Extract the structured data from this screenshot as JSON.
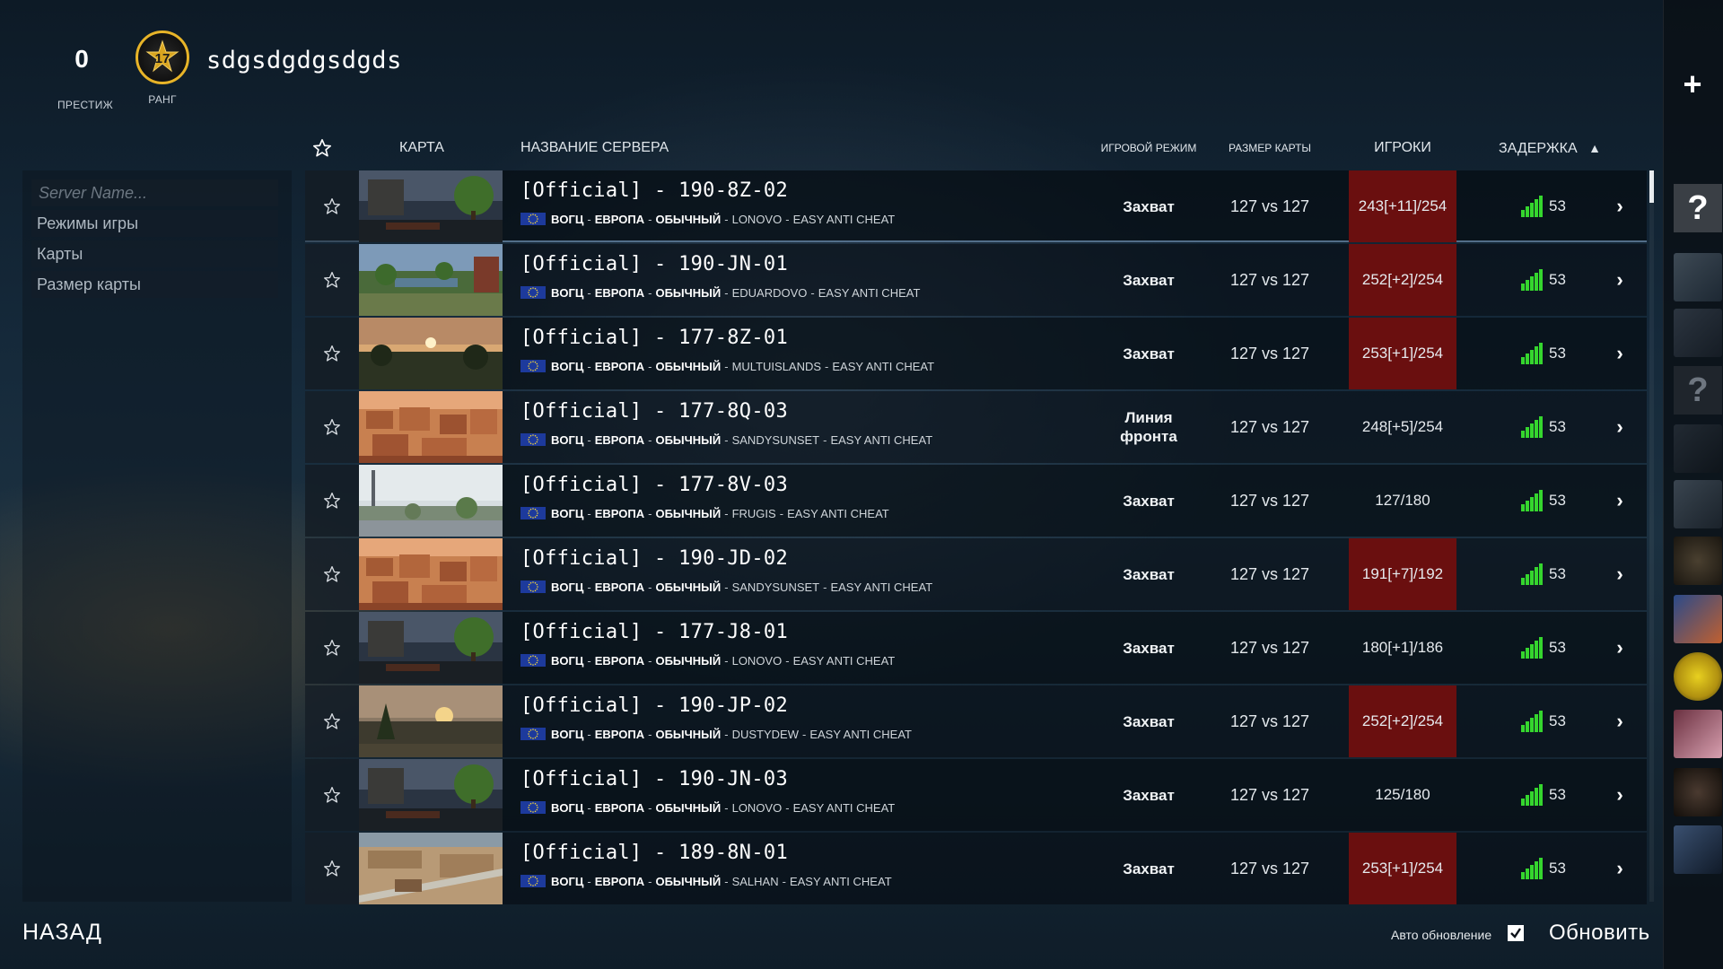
{
  "header": {
    "prestige_value": "0",
    "prestige_label": "ПРЕСТИЖ",
    "rank_value": "17",
    "rank_label": "РАНГ",
    "username": "sdgsdgdgsdgds"
  },
  "filters": {
    "search_placeholder": "Server Name...",
    "items": [
      "Режимы игры",
      "Карты",
      "Размер карты"
    ]
  },
  "columns": {
    "map": "КАРТА",
    "server_name": "НАЗВАНИЕ СЕРВЕРА",
    "game_mode": "ИГРОВОЙ РЕЖИМ",
    "map_size": "РАЗМЕР КАРТЫ",
    "players": "ИГРОКИ",
    "ping": "ЗАДЕРЖКА",
    "sort_indicator": "▲"
  },
  "common": {
    "game": "BOГЦ",
    "region": "ЕВРОПА",
    "type": "ОБЫЧНЫЙ",
    "anticheat": "EASY ANTI CHEAT",
    "dash": "-"
  },
  "servers": [
    {
      "name": "[Official] - 190-8Z-02",
      "map": "LONOVO",
      "mode": "Захват",
      "size": "127 vs 127",
      "players": "243[+11]/254",
      "ping": "53",
      "full": true,
      "thumb": "lonovo"
    },
    {
      "name": "[Official] - 190-JN-01",
      "map": "EDUARDOVO",
      "mode": "Захват",
      "size": "127 vs 127",
      "players": "252[+2]/254",
      "ping": "53",
      "full": true,
      "thumb": "eduardovo"
    },
    {
      "name": "[Official] - 177-8Z-01",
      "map": "MULTUISLANDS",
      "mode": "Захват",
      "size": "127 vs 127",
      "players": "253[+1]/254",
      "ping": "53",
      "full": true,
      "thumb": "islands"
    },
    {
      "name": "[Official] - 177-8Q-03",
      "map": "SANDYSUNSET",
      "mode": "Линия фронта",
      "size": "127 vs 127",
      "players": "248[+5]/254",
      "ping": "53",
      "full": false,
      "thumb": "sandy"
    },
    {
      "name": "[Official] - 177-8V-03",
      "map": "FRUGIS",
      "mode": "Захват",
      "size": "127 vs 127",
      "players": "127/180",
      "ping": "53",
      "full": false,
      "thumb": "frugis"
    },
    {
      "name": "[Official] - 190-JD-02",
      "map": "SANDYSUNSET",
      "mode": "Захват",
      "size": "127 vs 127",
      "players": "191[+7]/192",
      "ping": "53",
      "full": true,
      "thumb": "sandy"
    },
    {
      "name": "[Official] - 177-J8-01",
      "map": "LONOVO",
      "mode": "Захват",
      "size": "127 vs 127",
      "players": "180[+1]/186",
      "ping": "53",
      "full": false,
      "thumb": "lonovo"
    },
    {
      "name": "[Official] - 190-JP-02",
      "map": "DUSTYDEW",
      "mode": "Захват",
      "size": "127 vs 127",
      "players": "252[+2]/254",
      "ping": "53",
      "full": true,
      "thumb": "dusty"
    },
    {
      "name": "[Official] - 190-JN-03",
      "map": "LONOVO",
      "mode": "Захват",
      "size": "127 vs 127",
      "players": "125/180",
      "ping": "53",
      "full": false,
      "thumb": "lonovo"
    },
    {
      "name": "[Official] - 189-8N-01",
      "map": "SALHAN",
      "mode": "Захват",
      "size": "127 vs 127",
      "players": "253[+1]/254",
      "ping": "53",
      "full": true,
      "thumb": "salhan"
    }
  ],
  "side": {
    "plus": "+",
    "help": "?",
    "help2": "?"
  },
  "footer": {
    "back": "НАЗАД",
    "auto_refresh": "Авто обновление",
    "refresh": "Обновить"
  },
  "colors": {
    "full_server": "#6a0f0f",
    "ping_bars": "#35d62e",
    "rank_ring": "#e8b428",
    "region_flag": "#1d3a9c"
  }
}
